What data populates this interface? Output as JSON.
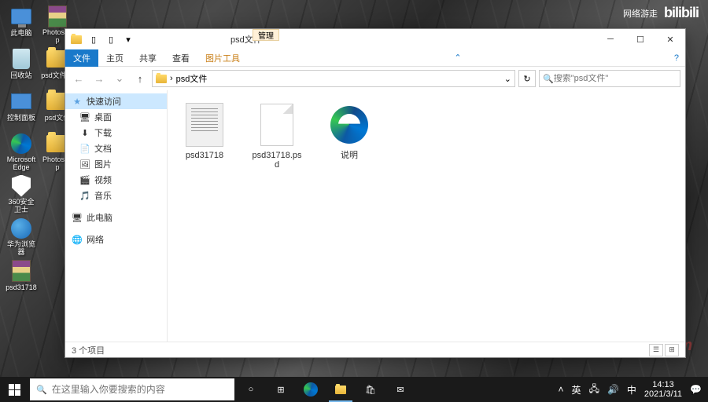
{
  "topright": {
    "category": "网络游走",
    "brand": "bilibili"
  },
  "watermark": "Yuncn.com",
  "desktop": {
    "col1": [
      {
        "label": "此电脑",
        "icon": "pc"
      },
      {
        "label": "回收站",
        "icon": "bin"
      },
      {
        "label": "控制面板",
        "icon": "cp"
      },
      {
        "label": "Microsoft Edge",
        "icon": "edge"
      },
      {
        "label": "360安全卫士",
        "icon": "shield"
      },
      {
        "label": "华为浏览器",
        "icon": "globe"
      },
      {
        "label": "psd31718",
        "icon": "winrar"
      }
    ],
    "col2": [
      {
        "label": "Photoshop",
        "icon": "winrar"
      },
      {
        "label": "psd文件夹",
        "icon": "folder"
      },
      {
        "label": "psd文件",
        "icon": "folder"
      },
      {
        "label": "Photoshop",
        "icon": "folder"
      }
    ]
  },
  "explorer": {
    "qat_manage": "管理",
    "title": "psd文件",
    "winbtns": {
      "min": "─",
      "max": "☐",
      "close": "✕"
    },
    "ribbon": {
      "file": "文件",
      "home": "主页",
      "share": "共享",
      "view": "查看",
      "pictools": "图片工具",
      "collapse": "⌃",
      "help": "?"
    },
    "nav": {
      "back": "←",
      "fwd": "→",
      "up": "↑",
      "dropdown": "⌄"
    },
    "address": {
      "path": "psd文件",
      "sep": "›",
      "refresh": "↻",
      "dropdown": "⌄"
    },
    "search": {
      "placeholder": "搜索\"psd文件\"",
      "icon": "🔍"
    },
    "sidebar": {
      "quick": "快速访问",
      "items": [
        {
          "icon": "🖥",
          "label": "桌面"
        },
        {
          "icon": "⬇",
          "label": "下载"
        },
        {
          "icon": "📄",
          "label": "文档"
        },
        {
          "icon": "🖼",
          "label": "图片"
        },
        {
          "icon": "🎬",
          "label": "视频"
        },
        {
          "icon": "🎵",
          "label": "音乐"
        }
      ],
      "thispc": "此电脑",
      "network": "网络"
    },
    "files": [
      {
        "name": "psd31718",
        "thumb": "doc"
      },
      {
        "name": "psd31718.psd",
        "thumb": "blank"
      },
      {
        "name": "说明",
        "thumb": "edge"
      }
    ],
    "status": "3 个项目"
  },
  "taskbar": {
    "search_placeholder": "在这里输入你要搜索的内容",
    "search_icon": "🔍",
    "cortana": "○",
    "taskview": "⊞",
    "tray": {
      "up": "˄",
      "ime": "英",
      "net": "🖧",
      "vol": "🔊",
      "lang": "中"
    },
    "time": "14:13",
    "date": "2021/3/11",
    "notif": "💬"
  }
}
